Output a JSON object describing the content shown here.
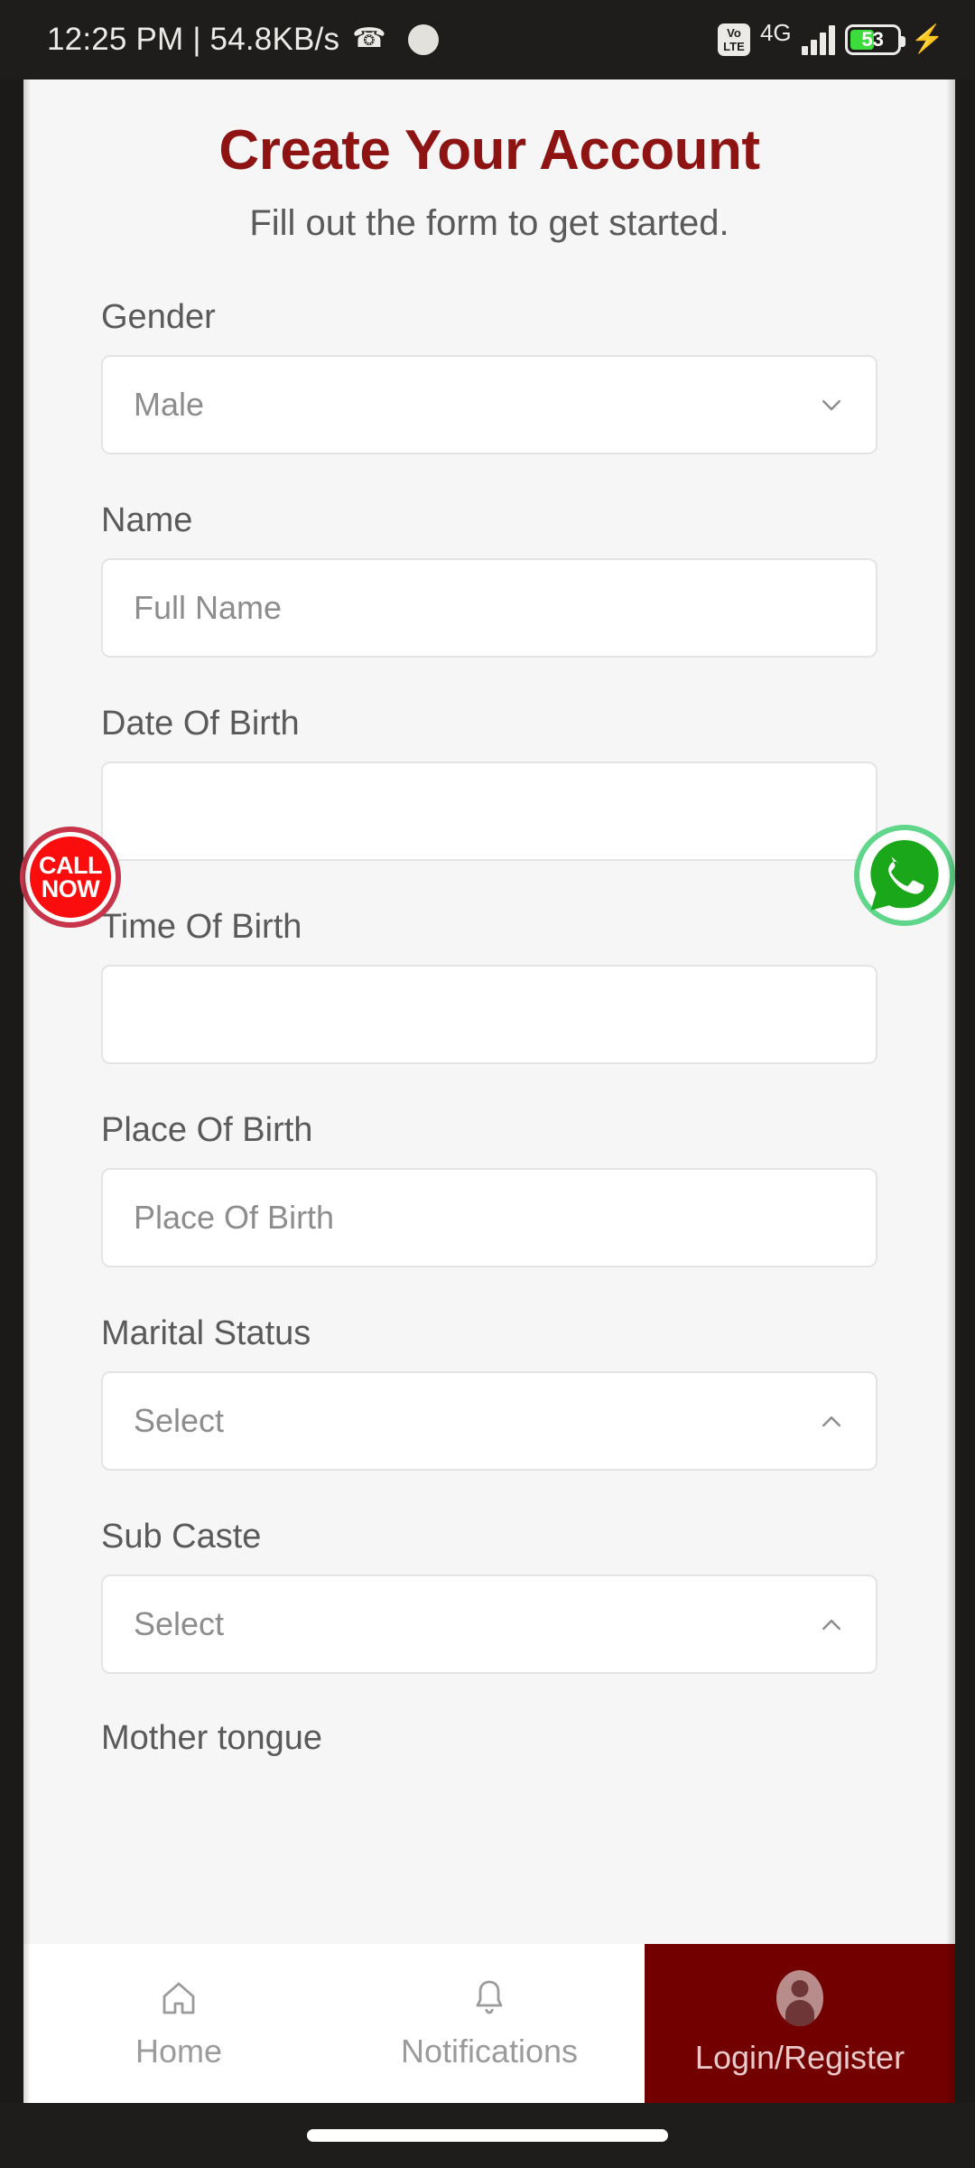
{
  "status_bar": {
    "clock_and_net": "12:25 PM | 54.8KB/s",
    "call_icon": "phone-handset-icon",
    "camera_dot": "camera-punch-hole",
    "volte_line1": "Vo",
    "volte_line2": "LTE",
    "network_type": "4G",
    "signal_icon": "signal-bars-icon",
    "battery_percent": "53",
    "battery_level": 53,
    "charging_icon": "charging-bolt-icon"
  },
  "header": {
    "title": "Create Your Account",
    "subtitle": "Fill out the form to get started.",
    "title_color": "#8e1414"
  },
  "form": {
    "gender": {
      "label": "Gender",
      "value": "Male",
      "chevron": "chevron-down-icon"
    },
    "name": {
      "label": "Name",
      "placeholder": "Full Name",
      "value": ""
    },
    "date_of_birth": {
      "label": "Date Of Birth",
      "placeholder": "",
      "value": ""
    },
    "time_of_birth": {
      "label": "Time Of Birth",
      "placeholder": "",
      "value": ""
    },
    "place_of_birth": {
      "label": "Place Of Birth",
      "placeholder": "Place Of Birth",
      "value": ""
    },
    "marital_status": {
      "label": "Marital Status",
      "value": "Select",
      "chevron": "chevron-up-icon"
    },
    "sub_caste": {
      "label": "Sub Caste",
      "value": "Select",
      "chevron": "chevron-up-icon"
    },
    "mother_tongue": {
      "label": "Mother  tongue"
    }
  },
  "floating_buttons": {
    "call_now": {
      "line1": "CALL",
      "line2": "NOW",
      "color": "#fb0d0d",
      "ring_color": "#c8354a"
    },
    "whatsapp": {
      "icon": "whatsapp-icon",
      "color": "#1aa81a",
      "ring_color": "#5fd68a"
    }
  },
  "bottom_nav": {
    "items": [
      {
        "label": "Home",
        "icon": "home-icon",
        "active": false
      },
      {
        "label": "Notifications",
        "icon": "bell-icon",
        "active": false
      },
      {
        "label": "Login/Register",
        "icon": "user-avatar-icon",
        "active": true
      }
    ],
    "active_bg": "#720000",
    "active_text": "#e9c9c9"
  }
}
